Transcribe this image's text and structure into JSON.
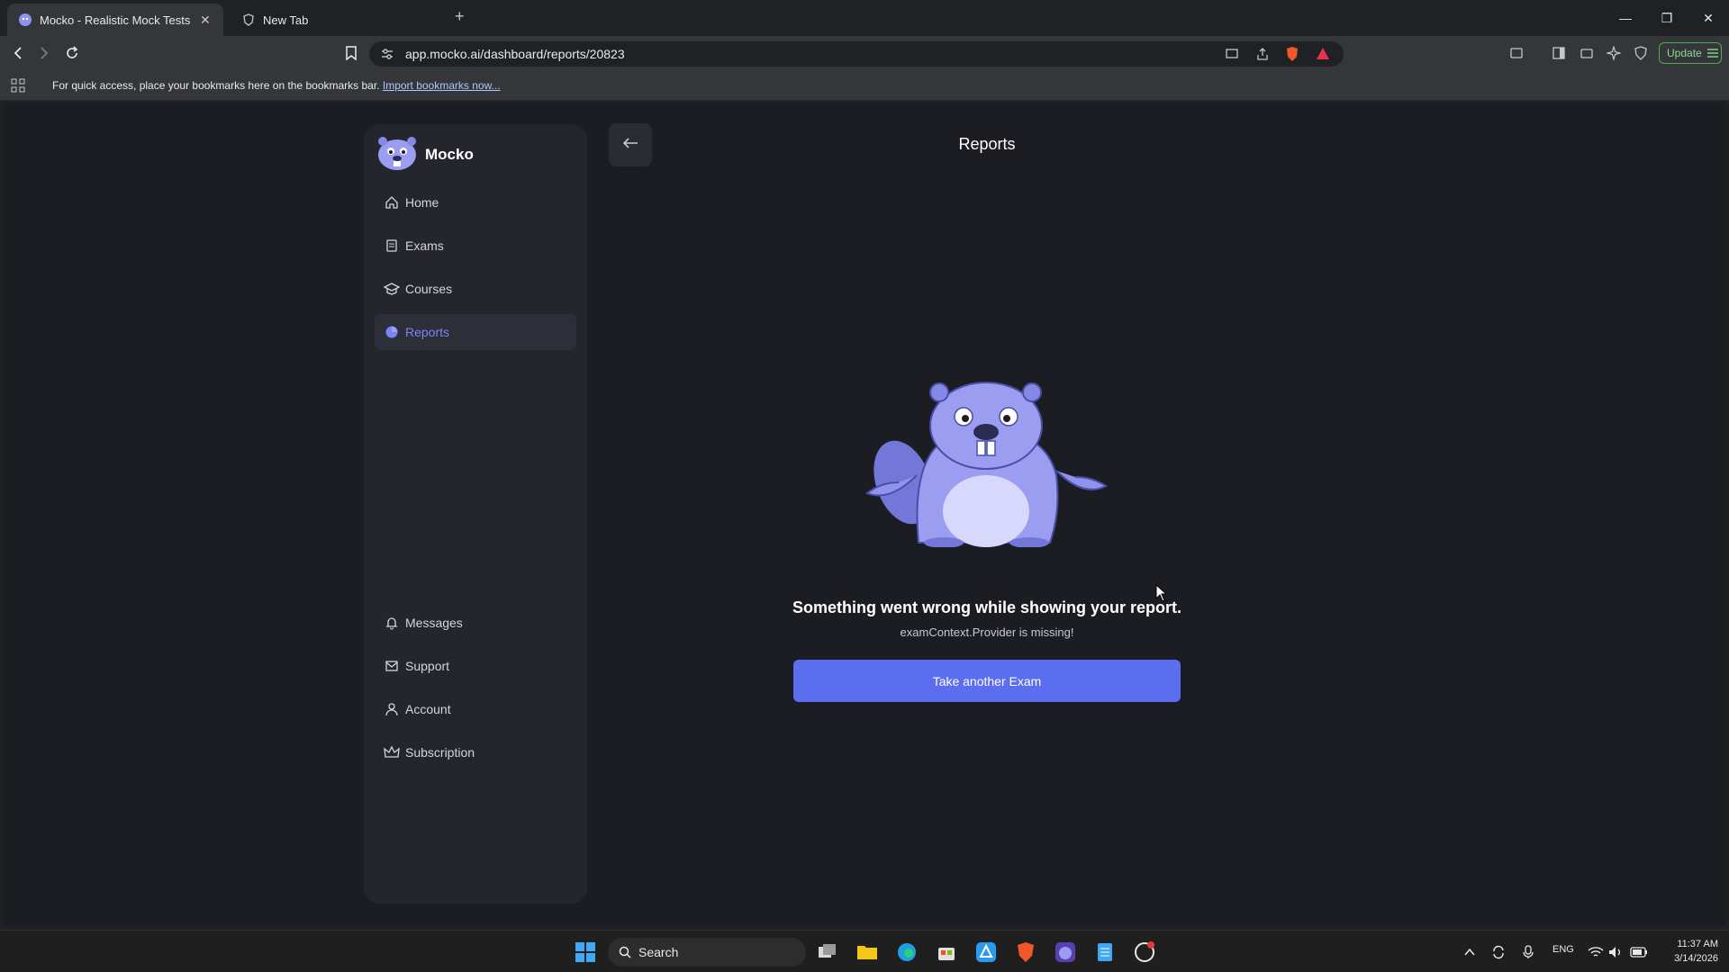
{
  "browser": {
    "tabs": [
      {
        "title": "Mocko - Realistic Mock Tests wit",
        "active": true
      },
      {
        "title": "New Tab",
        "active": false
      }
    ],
    "new_tab_symbol": "+",
    "url": "app.mocko.ai/dashboard/reports/20823",
    "update_label": "Update",
    "bookmarks_bar": {
      "text": "For quick access, place your bookmarks here on the bookmarks bar.",
      "link": "Import bookmarks now..."
    }
  },
  "sidebar": {
    "brand": "Mocko",
    "items": [
      {
        "label": "Home",
        "icon": "home-icon"
      },
      {
        "label": "Exams",
        "icon": "document-icon"
      },
      {
        "label": "Courses",
        "icon": "graduation-cap-icon"
      },
      {
        "label": "Reports",
        "icon": "pie-chart-icon",
        "active": true
      }
    ],
    "bottom_items": [
      {
        "label": "Messages",
        "icon": "bell-icon"
      },
      {
        "label": "Support",
        "icon": "mail-icon"
      },
      {
        "label": "Account",
        "icon": "user-icon"
      },
      {
        "label": "Subscription",
        "icon": "crown-icon"
      }
    ]
  },
  "main": {
    "title": "Reports",
    "error_title": "Something went wrong while showing your report.",
    "error_detail": "examContext.Provider is missing!",
    "cta_label": "Take another Exam"
  },
  "taskbar": {
    "search_label": "Search",
    "language": "ENG",
    "time": "11:37 AM",
    "date": "3/14/2026"
  },
  "colors": {
    "accent": "#5b6ef0",
    "active_nav": "#7b84f5",
    "beaver": "#9b9ef0"
  }
}
